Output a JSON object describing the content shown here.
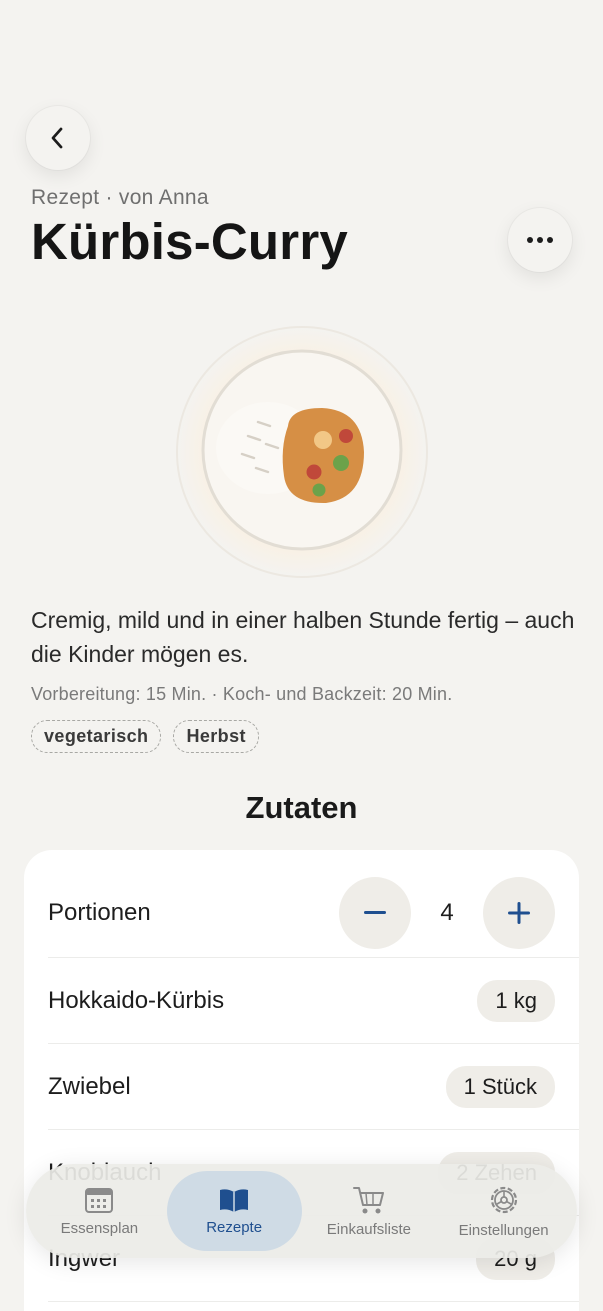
{
  "header": {
    "subtitle": "Rezept · von Anna",
    "title": "Kürbis-Curry",
    "back_icon": "chevron-left-icon",
    "more_icon": "ellipsis-icon"
  },
  "recipe": {
    "description": "Cremig, mild und in einer halben Stunde fertig – auch die Kinder mögen es.",
    "meta": "Vorbereitung: 15 Min. · Koch- und Backzeit: 20 Min.",
    "tags": [
      "vegetarisch",
      "Herbst"
    ]
  },
  "ingredients": {
    "section_title": "Zutaten",
    "portions_label": "Portionen",
    "portions_value": "4",
    "items": [
      {
        "name": "Hokkaido-Kürbis",
        "amount": "1 kg"
      },
      {
        "name": "Zwiebel",
        "amount": "1 Stück"
      },
      {
        "name": "Knoblauch",
        "amount": "2 Zehen"
      },
      {
        "name": "Ingwer",
        "amount": "20 g"
      }
    ]
  },
  "tabbar": {
    "tabs": [
      {
        "label": "Essensplan",
        "icon": "calendar-icon"
      },
      {
        "label": "Rezepte",
        "icon": "book-icon"
      },
      {
        "label": "Einkaufsliste",
        "icon": "cart-icon"
      },
      {
        "label": "Einstellungen",
        "icon": "gear-icon"
      }
    ]
  },
  "colors": {
    "background": "#f4f3f0",
    "accent": "#1f4f8f",
    "active_tab": "#cfdbe5",
    "curry": "#d68f45"
  }
}
